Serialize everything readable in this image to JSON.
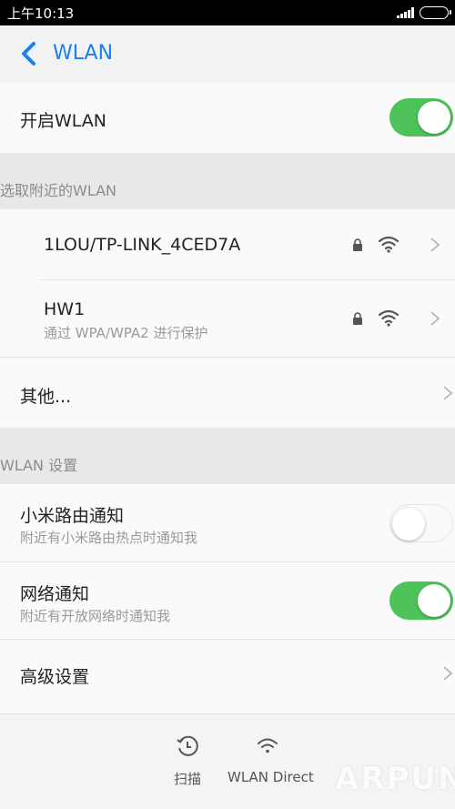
{
  "status_bar": {
    "time": "上午10:13"
  },
  "header": {
    "title": "WLAN"
  },
  "wlan_toggle": {
    "label": "开启WLAN",
    "on": true
  },
  "nearby_section": {
    "label": "选取附近的WLAN"
  },
  "networks": [
    {
      "ssid": "1LOU/TP-LINK_4CED7A",
      "subtitle": ""
    },
    {
      "ssid": "HW1",
      "subtitle": "通过 WPA/WPA2 进行保护"
    }
  ],
  "other": {
    "label": "其他..."
  },
  "settings_section": {
    "label": "WLAN 设置"
  },
  "xiaomi_router": {
    "label": "小米路由通知",
    "subtitle": "附近有小米路由热点时通知我",
    "on": false
  },
  "network_notify": {
    "label": "网络通知",
    "subtitle": "附近有开放网络时通知我",
    "on": true
  },
  "advanced": {
    "label": "高级设置"
  },
  "bottom_bar": {
    "scan_label": "扫描",
    "direct_label": "WLAN Direct"
  },
  "watermark": {
    "text": "ARPUN"
  },
  "colors": {
    "accent": "#1a7ff0",
    "toggle_on": "#4dc35a"
  }
}
